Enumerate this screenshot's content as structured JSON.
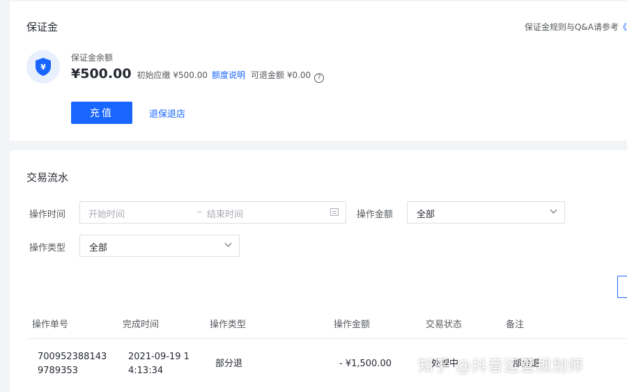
{
  "deposit": {
    "title": "保证金",
    "rules_text": "保证金规则与Q&A请参考",
    "rules_link": "《",
    "shield_icon": "yuan-shield-icon",
    "balance_label": "保证金余额",
    "balance_amount": "¥500.00",
    "initial_text": "初始应缴 ¥500.00",
    "quota_link": "额度说明",
    "refundable_text": "可退金额 ¥0.00",
    "help_symbol": "?",
    "recharge_button": "充值",
    "withdraw_link": "退保退店"
  },
  "transactions": {
    "title": "交易流水",
    "filters": {
      "time_label": "操作时间",
      "start_placeholder": "开始时间",
      "range_separator": "–",
      "end_placeholder": "结束时间",
      "amount_label": "操作金额",
      "amount_value": "全部",
      "type_label": "操作类型",
      "type_value": "全部"
    },
    "columns": [
      "操作单号",
      "完成时间",
      "操作类型",
      "操作金额",
      "交易状态",
      "备注"
    ],
    "rows": [
      {
        "order_no_line1": "700952388143",
        "order_no_line2": "9789353",
        "time_line1": "2021-09-19 1",
        "time_line2": "4:13:34",
        "type": "部分退",
        "amount": "- ¥1,500.00",
        "status": "处理中",
        "note": "部分退"
      }
    ]
  },
  "watermark": "知乎 @抖音运营规划师",
  "colors": {
    "primary": "#1966ff",
    "background": "#f3f4f7",
    "text": "#252931",
    "secondary_text": "#55585c"
  }
}
